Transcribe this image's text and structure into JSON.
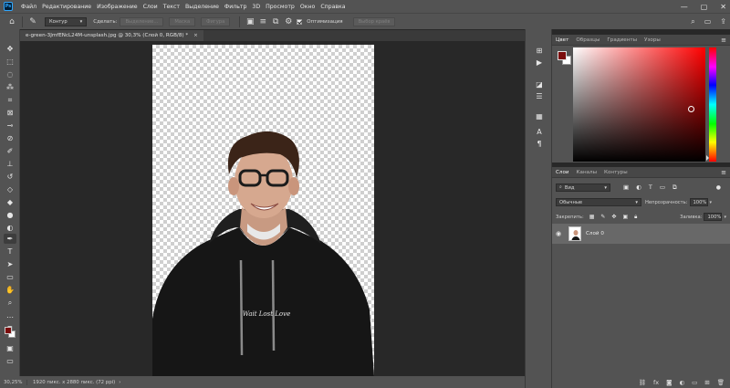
{
  "app": {
    "logo": "Ps"
  },
  "menu": [
    "Файл",
    "Редактирование",
    "Изображение",
    "Слои",
    "Текст",
    "Выделение",
    "Фильтр",
    "3D",
    "Просмотр",
    "Окно",
    "Справка"
  ],
  "options_bar": {
    "mode_value": "Контур",
    "make_label": "Сделать:",
    "selection_btn": "Выделение...",
    "mask_btn": "Маска",
    "shape_btn": "Фигура",
    "optimize_label": "Оптимизация",
    "select_subject_btn": "Выбор краёв",
    "optimize_checked": true
  },
  "document": {
    "tab_title": "e-green-3JmfENcL24M-unsplash.jpg @ 30,3% (Слой 0, RGB/8) *",
    "close": "×"
  },
  "status": {
    "zoom": "30,25%",
    "info": "1920 пикс. x 2880 пикс. (72 ppi)",
    "arrow": "›"
  },
  "color_panel": {
    "tabs": [
      "Цвет",
      "Образцы",
      "Градиенты",
      "Узоры"
    ],
    "active_tab": "Цвет",
    "foreground": "#7b0d0d",
    "background": "#ffffff"
  },
  "layers_panel": {
    "tabs": [
      "Слои",
      "Каналы",
      "Контуры"
    ],
    "active_tab": "Слои",
    "filter_value": "Вид",
    "blend_mode": "Обычные",
    "opacity_label": "Непрозрачность:",
    "opacity_value": "100%",
    "lock_label": "Закрепить:",
    "fill_label": "Заливка:",
    "fill_value": "100%",
    "layers": [
      {
        "name": "Слой 0",
        "visible": true
      }
    ]
  },
  "icons": {
    "home": "⌂",
    "pen": "✎",
    "search": "⌕",
    "panels": "▭",
    "share": "⇪",
    "gear": "⚙",
    "minimize": "—",
    "maximize": "▢",
    "close": "✕",
    "menu": "≡",
    "eye": "👁"
  },
  "hoodie_text": "Wait Lost Love"
}
